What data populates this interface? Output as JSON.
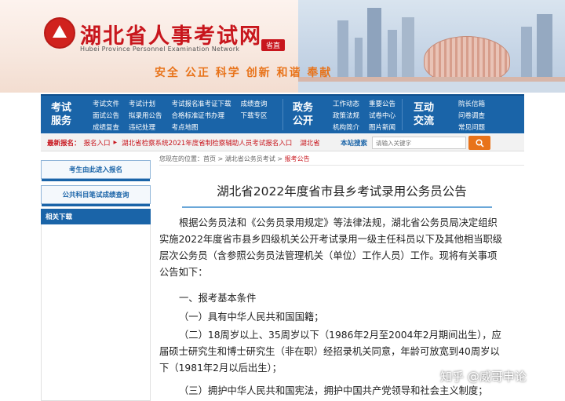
{
  "header": {
    "site_title": "湖北省人事考试网",
    "site_subtitle": "Hubei Province Personnel Examination Network",
    "province_badge": "省直",
    "slogan": "安全 公正 科学 创新 和谐 奉献"
  },
  "nav": {
    "sections": [
      {
        "label_1": "考试",
        "label_2": "服务",
        "links": [
          "考试文件",
          "考试计划",
          "考试报名",
          "准考证下载",
          "成绩查询",
          "面试公告",
          "拟录用公告",
          "合格标准",
          "证书办理",
          "下载专区",
          "成绩复查",
          "违纪处理",
          "考点地图"
        ]
      },
      {
        "label_1": "政务",
        "label_2": "公开",
        "links": [
          "工作动态",
          "重要公告",
          "政策法规",
          "试卷中心",
          "机构简介",
          "图片新闻"
        ]
      },
      {
        "label_1": "互动",
        "label_2": "交流",
        "links": [
          "院长信箱",
          "问卷调查",
          "常见问题"
        ]
      }
    ]
  },
  "latest": {
    "label": "最新报名：",
    "links": [
      "报名入口",
      "湖北省检察系统2021年度省制检察辅助人员考试报名入口",
      "湖北省"
    ],
    "search_label": "本站搜索",
    "search_placeholder": "请输入关键字"
  },
  "sidebar": {
    "buttons": [
      "考生由此进入报名",
      "公共科目笔试成绩查询"
    ],
    "downloads_title": "相关下载"
  },
  "breadcrumb": {
    "prefix": "您现在的位置：首页",
    "items": [
      "湖北省公务员考试"
    ],
    "current": "报考公告"
  },
  "article": {
    "title": "湖北省2022年度省市县乡考试录用公务员公告",
    "paragraphs": [
      "根据公务员法和《公务员录用规定》等法律法规，湖北省公务员局决定组织实施2022年度省市县乡四级机关公开考试录用一级主任科员以下及其他相当职级层次公务员（含参照公务员法管理机关（单位）工作人员）工作。现将有关事项公告如下：",
      "一、报考基本条件",
      "（一）具有中华人民共和国国籍；",
      "（二）18周岁以上、35周岁以下（1986年2月至2004年2月期间出生），应届硕士研究生和博士研究生（非在职）经招录机关同意，年龄可放宽到40周岁以下（1981年2月以后出生）；",
      "（三）拥护中华人民共和国宪法，拥护中国共产党领导和社会主义制度；"
    ]
  },
  "watermark": "知乎 @威哥申论",
  "colors": {
    "nav_blue": "#1a64a8",
    "brand_red": "#c8161d",
    "accent_orange": "#e8731a"
  }
}
